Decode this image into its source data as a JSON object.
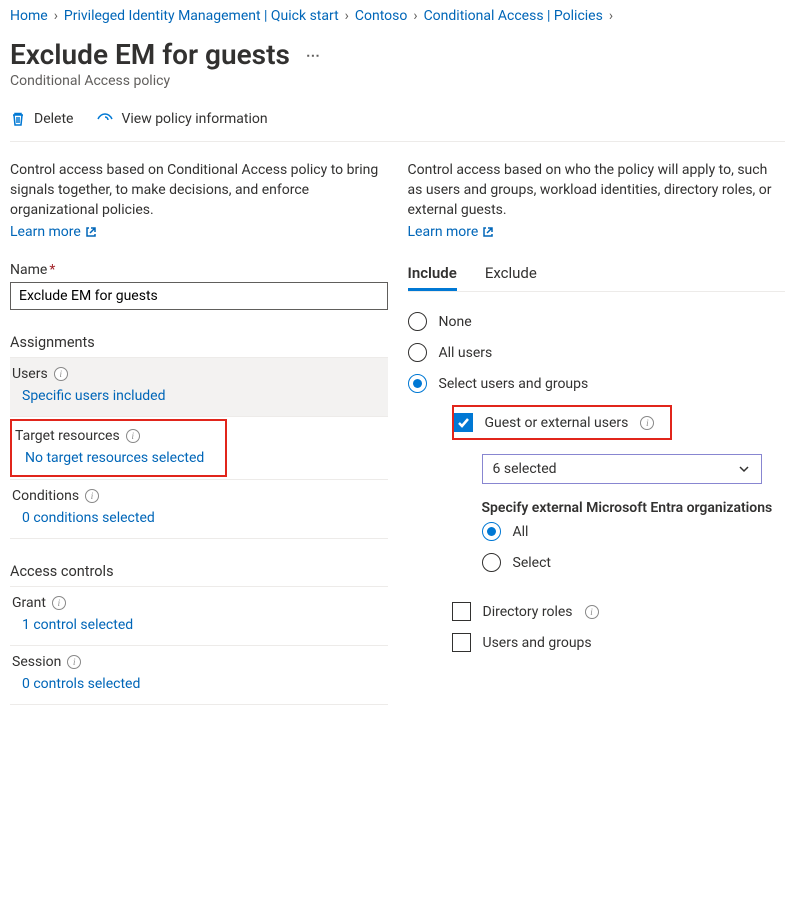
{
  "breadcrumb": [
    "Home",
    "Privileged Identity Management | Quick start",
    "Contoso",
    "Conditional Access | Policies"
  ],
  "page": {
    "title": "Exclude EM for guests",
    "subtitle": "Conditional Access policy"
  },
  "toolbar": {
    "delete": "Delete",
    "view_info": "View policy information"
  },
  "left": {
    "desc": "Control access based on Conditional Access policy to bring signals together, to make decisions, and enforce organizational policies.",
    "learn_more": "Learn more",
    "name_label": "Name",
    "name_value": "Exclude EM for guests",
    "assignments_head": "Assignments",
    "users_label": "Users",
    "users_value": "Specific users included",
    "target_label": "Target resources",
    "target_value": "No target resources selected",
    "conditions_label": "Conditions",
    "conditions_value": "0 conditions selected",
    "controls_head": "Access controls",
    "grant_label": "Grant",
    "grant_value": "1 control selected",
    "session_label": "Session",
    "session_value": "0 controls selected"
  },
  "right": {
    "desc": "Control access based on who the policy will apply to, such as users and groups, workload identities, directory roles, or external guests.",
    "learn_more": "Learn more",
    "tab_include": "Include",
    "tab_exclude": "Exclude",
    "opt_none": "None",
    "opt_all": "All users",
    "opt_select": "Select users and groups",
    "chk_guest": "Guest or external users",
    "select_value": "6 selected",
    "specify_head": "Specify external Microsoft Entra organizations",
    "opt_orgs_all": "All",
    "opt_orgs_select": "Select",
    "chk_roles": "Directory roles",
    "chk_users_groups": "Users and groups"
  }
}
